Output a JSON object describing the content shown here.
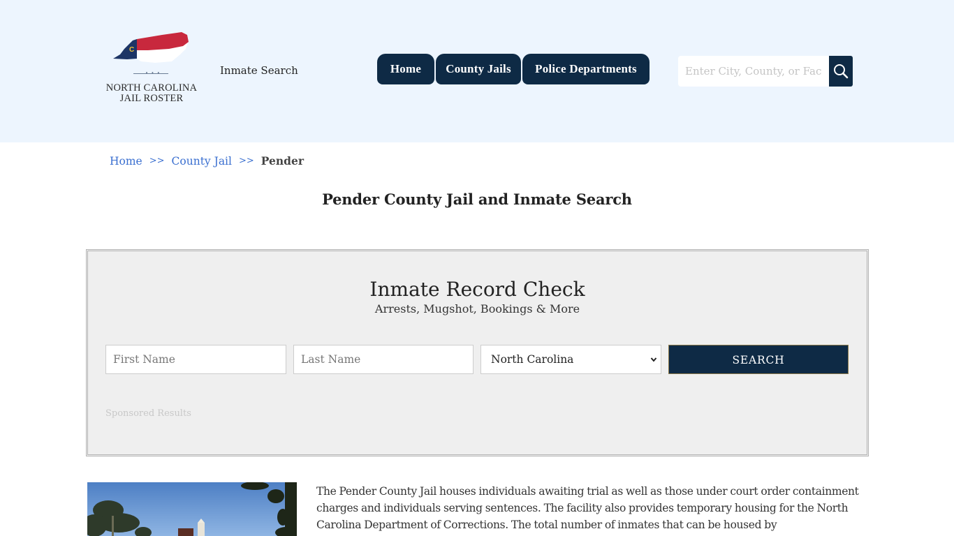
{
  "header": {
    "logo": {
      "line1": "NORTH CAROLINA",
      "line2": "JAIL ROSTER",
      "icon": "north-carolina-flag-map-icon",
      "dots": "• • •"
    },
    "inmate_search_link": "Inmate Search",
    "nav": [
      {
        "label": "Home"
      },
      {
        "label": "County Jails"
      },
      {
        "label": "Police Departments"
      }
    ],
    "search": {
      "placeholder": "Enter City, County, or Facility",
      "button_icon": "search-icon"
    }
  },
  "breadcrumb": {
    "items": [
      {
        "label": "Home"
      },
      {
        "label": "County Jail"
      },
      {
        "label": "Pender"
      }
    ],
    "separator": ">>"
  },
  "page_title": "Pender County Jail and Inmate Search",
  "record_check": {
    "title": "Inmate Record Check",
    "subtitle": "Arrests, Mugshot, Bookings & More",
    "first_name_placeholder": "First Name",
    "last_name_placeholder": "Last Name",
    "state_selected": "North Carolina",
    "search_button": "SEARCH",
    "sponsored_label": "Sponsored Results"
  },
  "content": {
    "photo_alt": "Pender County Jail building photo",
    "description": "The Pender County Jail houses individuals awaiting trial as well as those under court order containment charges and individuals serving sentences. The facility also provides temporary housing for the North Carolina Department of Corrections. The total number of inmates that can be housed by"
  },
  "colors": {
    "header_bg": "#edf5fe",
    "brand_navy": "#0e2a45",
    "link_blue": "#3a6fd0",
    "box_bg": "#efefef"
  }
}
